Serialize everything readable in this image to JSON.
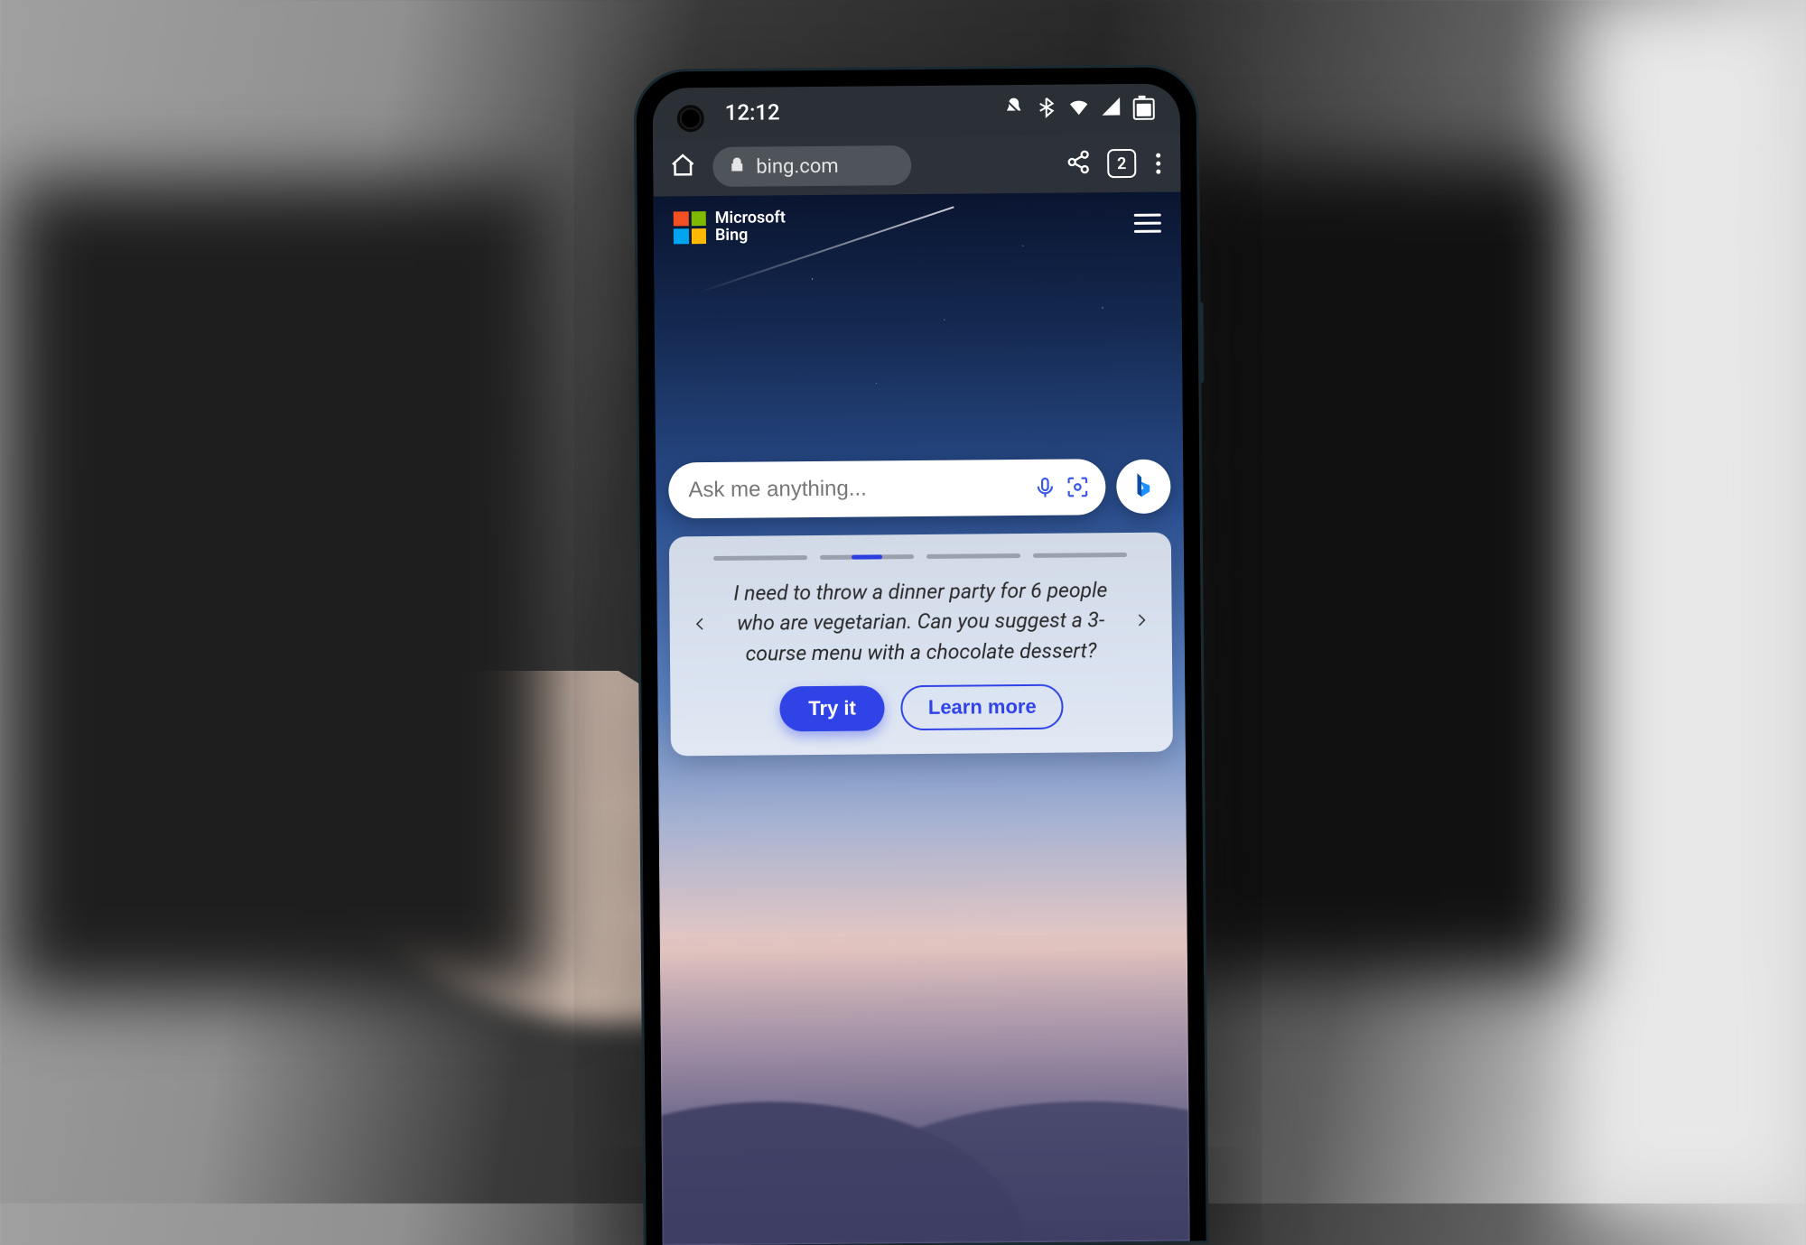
{
  "statusbar": {
    "time": "12:12"
  },
  "browser": {
    "url": "bing.com",
    "tab_count": "2"
  },
  "header": {
    "brand_line1": "Microsoft",
    "brand_line2": "Bing"
  },
  "search": {
    "placeholder": "Ask me anything..."
  },
  "promo": {
    "carousel": {
      "count": 4,
      "active_index": 1
    },
    "text": "I need to throw a dinner party for 6 people who are vegetarian. Can you suggest a 3-course menu with a chocolate dessert?",
    "cta_primary": "Try it",
    "cta_secondary": "Learn more"
  },
  "colors": {
    "accent": "#3043e6"
  }
}
